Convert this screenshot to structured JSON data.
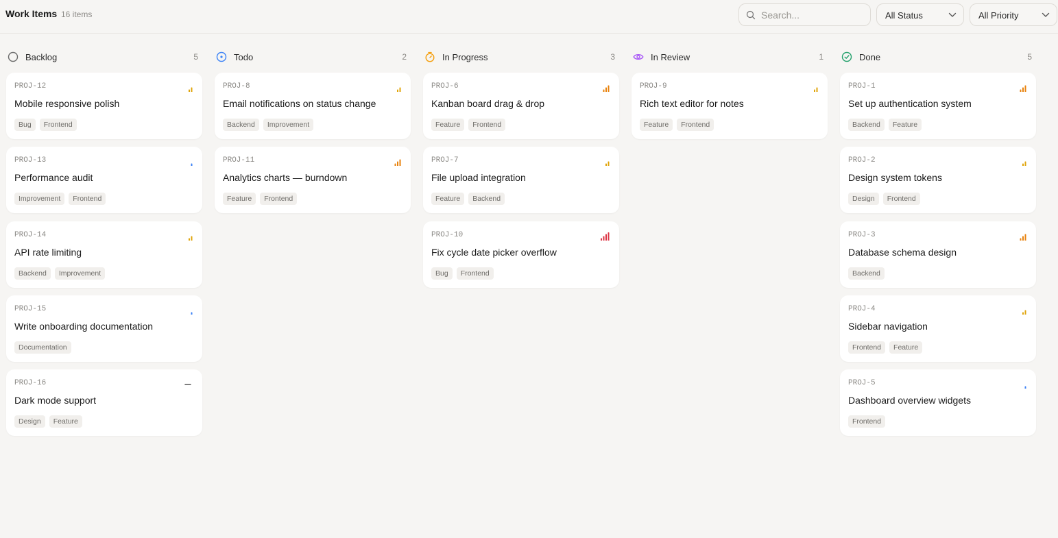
{
  "header": {
    "title": "Work Items",
    "count": "16 items",
    "search_placeholder": "Search...",
    "status_filter": "All Status",
    "priority_filter": "All Priority"
  },
  "colors": {
    "backlog": "#6b6b6b",
    "todo": "#3b82f6",
    "in_progress": "#f59e0b",
    "in_review": "#a855f7",
    "done": "#22a06b",
    "prio_urgent": "#dc3545",
    "prio_high": "#e8820c",
    "prio_medium": "#e0a40a",
    "prio_low": "#3b82f6"
  },
  "columns": [
    {
      "key": "backlog",
      "name": "Backlog",
      "count": "5",
      "icon": "circle-outline-icon",
      "cards": [
        {
          "id": "PROJ-12",
          "title": "Mobile responsive polish",
          "tags": [
            "Bug",
            "Frontend"
          ],
          "priority": "medium"
        },
        {
          "id": "PROJ-13",
          "title": "Performance audit",
          "tags": [
            "Improvement",
            "Frontend"
          ],
          "priority": "low"
        },
        {
          "id": "PROJ-14",
          "title": "API rate limiting",
          "tags": [
            "Backend",
            "Improvement"
          ],
          "priority": "medium"
        },
        {
          "id": "PROJ-15",
          "title": "Write onboarding documentation",
          "tags": [
            "Documentation"
          ],
          "priority": "low"
        },
        {
          "id": "PROJ-16",
          "title": "Dark mode support",
          "tags": [
            "Design",
            "Feature"
          ],
          "priority": "none"
        }
      ]
    },
    {
      "key": "todo",
      "name": "Todo",
      "count": "2",
      "icon": "circle-dot-icon",
      "cards": [
        {
          "id": "PROJ-8",
          "title": "Email notifications on status change",
          "tags": [
            "Backend",
            "Improvement"
          ],
          "priority": "medium"
        },
        {
          "id": "PROJ-11",
          "title": "Analytics charts — burndown",
          "tags": [
            "Feature",
            "Frontend"
          ],
          "priority": "high"
        }
      ]
    },
    {
      "key": "in_progress",
      "name": "In Progress",
      "count": "3",
      "icon": "timer-icon",
      "cards": [
        {
          "id": "PROJ-6",
          "title": "Kanban board drag & drop",
          "tags": [
            "Feature",
            "Frontend"
          ],
          "priority": "high"
        },
        {
          "id": "PROJ-7",
          "title": "File upload integration",
          "tags": [
            "Feature",
            "Backend"
          ],
          "priority": "medium"
        },
        {
          "id": "PROJ-10",
          "title": "Fix cycle date picker overflow",
          "tags": [
            "Bug",
            "Frontend"
          ],
          "priority": "urgent"
        }
      ]
    },
    {
      "key": "in_review",
      "name": "In Review",
      "count": "1",
      "icon": "eye-icon",
      "cards": [
        {
          "id": "PROJ-9",
          "title": "Rich text editor for notes",
          "tags": [
            "Feature",
            "Frontend"
          ],
          "priority": "medium"
        }
      ]
    },
    {
      "key": "done",
      "name": "Done",
      "count": "5",
      "icon": "check-circle-icon",
      "cards": [
        {
          "id": "PROJ-1",
          "title": "Set up authentication system",
          "tags": [
            "Backend",
            "Feature"
          ],
          "priority": "high"
        },
        {
          "id": "PROJ-2",
          "title": "Design system tokens",
          "tags": [
            "Design",
            "Frontend"
          ],
          "priority": "medium"
        },
        {
          "id": "PROJ-3",
          "title": "Database schema design",
          "tags": [
            "Backend"
          ],
          "priority": "high"
        },
        {
          "id": "PROJ-4",
          "title": "Sidebar navigation",
          "tags": [
            "Frontend",
            "Feature"
          ],
          "priority": "medium"
        },
        {
          "id": "PROJ-5",
          "title": "Dashboard overview widgets",
          "tags": [
            "Frontend"
          ],
          "priority": "low"
        }
      ]
    }
  ]
}
